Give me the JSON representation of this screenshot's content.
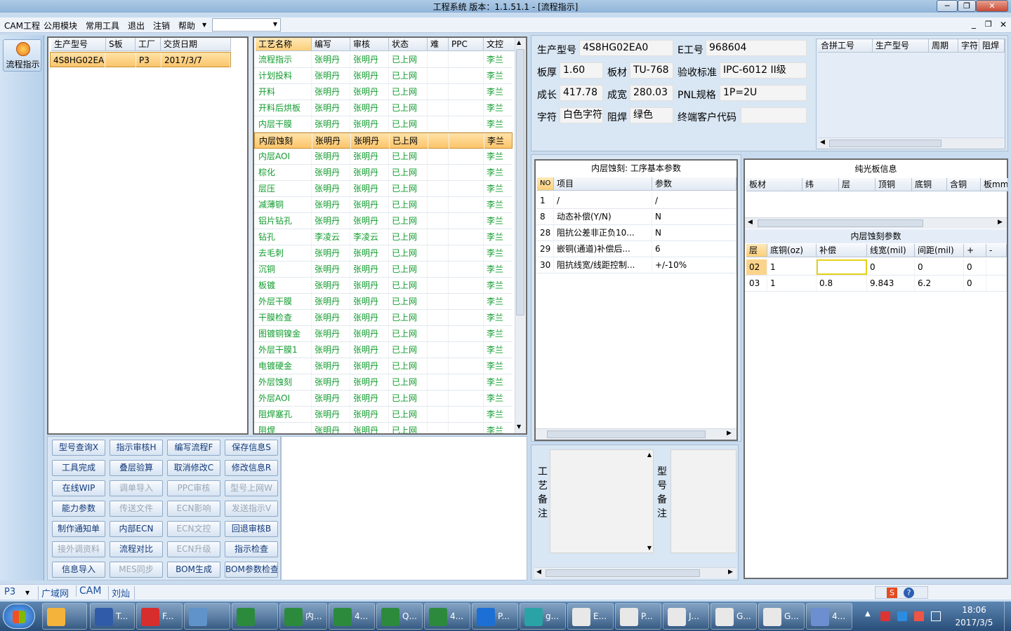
{
  "window": {
    "title": "工程系统   版本：1.1.51.1 - [流程指示]"
  },
  "menu": {
    "items": [
      "CAM工程",
      "公用模块",
      "常用工具",
      "退出",
      "注销",
      "帮助"
    ]
  },
  "left_nav": {
    "label": "流程指示"
  },
  "orders": {
    "headers": [
      "生产型号",
      "S板",
      "工厂",
      "交货日期"
    ],
    "rows": [
      {
        "model": "4S8HG02EA0",
        "s": "",
        "factory": "P3",
        "date": "2017/3/7"
      }
    ]
  },
  "process": {
    "headers": [
      "工艺名称",
      "编写",
      "审核",
      "状态",
      "难",
      "PPC",
      "文控"
    ],
    "rows": [
      [
        "流程指示",
        "张明丹",
        "张明丹",
        "已上网",
        "",
        "",
        "李兰"
      ],
      [
        "计划投料",
        "张明丹",
        "张明丹",
        "已上网",
        "",
        "",
        "李兰"
      ],
      [
        "开料",
        "张明丹",
        "张明丹",
        "已上网",
        "",
        "",
        "李兰"
      ],
      [
        "开料后烘板",
        "张明丹",
        "张明丹",
        "已上网",
        "",
        "",
        "李兰"
      ],
      [
        "内层干膜",
        "张明丹",
        "张明丹",
        "已上网",
        "",
        "",
        "李兰"
      ],
      [
        "内层蚀刻",
        "张明丹",
        "张明丹",
        "已上网",
        "",
        "",
        "李兰"
      ],
      [
        "内层AOI",
        "张明丹",
        "张明丹",
        "已上网",
        "",
        "",
        "李兰"
      ],
      [
        "棕化",
        "张明丹",
        "张明丹",
        "已上网",
        "",
        "",
        "李兰"
      ],
      [
        "层压",
        "张明丹",
        "张明丹",
        "已上网",
        "",
        "",
        "李兰"
      ],
      [
        "减薄铜",
        "张明丹",
        "张明丹",
        "已上网",
        "",
        "",
        "李兰"
      ],
      [
        "铝片钻孔",
        "张明丹",
        "张明丹",
        "已上网",
        "",
        "",
        "李兰"
      ],
      [
        "钻孔",
        "李凌云",
        "李凌云",
        "已上网",
        "",
        "",
        "李兰"
      ],
      [
        "去毛刺",
        "张明丹",
        "张明丹",
        "已上网",
        "",
        "",
        "李兰"
      ],
      [
        "沉铜",
        "张明丹",
        "张明丹",
        "已上网",
        "",
        "",
        "李兰"
      ],
      [
        "板镀",
        "张明丹",
        "张明丹",
        "已上网",
        "",
        "",
        "李兰"
      ],
      [
        "外层干膜",
        "张明丹",
        "张明丹",
        "已上网",
        "",
        "",
        "李兰"
      ],
      [
        "干膜检查",
        "张明丹",
        "张明丹",
        "已上网",
        "",
        "",
        "李兰"
      ],
      [
        "图镀铜镍金",
        "张明丹",
        "张明丹",
        "已上网",
        "",
        "",
        "李兰"
      ],
      [
        "外层干膜1",
        "张明丹",
        "张明丹",
        "已上网",
        "",
        "",
        "李兰"
      ],
      [
        "电镀硬金",
        "张明丹",
        "张明丹",
        "已上网",
        "",
        "",
        "李兰"
      ],
      [
        "外层蚀刻",
        "张明丹",
        "张明丹",
        "已上网",
        "",
        "",
        "李兰"
      ],
      [
        "外层AOI",
        "张明丹",
        "张明丹",
        "已上网",
        "",
        "",
        "李兰"
      ],
      [
        "阻焊塞孔",
        "张明丹",
        "张明丹",
        "已上网",
        "",
        "",
        "李兰"
      ],
      [
        "阻焊",
        "张明丹",
        "张明丹",
        "已上网",
        "",
        "",
        "李兰"
      ]
    ],
    "selected_index": 5
  },
  "buttons": [
    [
      "型号查询X",
      "指示审核H",
      "编写流程F",
      "保存信息S"
    ],
    [
      "工具完成",
      "叠层验算",
      "取消修改C",
      "修改信息R"
    ],
    [
      "在线WIP",
      "调单导入",
      "PPC审核",
      "型号上网W"
    ],
    [
      "能力参数",
      "传送文件",
      "ECN影响",
      "发送指示V"
    ],
    [
      "制作通知单",
      "内部ECN",
      "ECN文控",
      "回退审核B"
    ],
    [
      "接外调资料",
      "流程对比",
      "ECN升级",
      "指示检查"
    ],
    [
      "信息导入",
      "MES同步",
      "BOM生成",
      "BOM参数检查"
    ]
  ],
  "info": {
    "model_label": "生产型号",
    "model": "4S8HG02EA0",
    "e_label": "E工号",
    "e": "968604",
    "thick_label": "板厚",
    "thick": "1.60",
    "material_label": "板材",
    "material": "TU-768",
    "std_label": "验收标准",
    "std": "IPC-6012 II级",
    "len_label": "成长",
    "len": "417.78",
    "wid_label": "成宽",
    "wid": "280.03",
    "pnl_label": "PNL规格",
    "pnl": "1P=2U",
    "char_label": "字符",
    "char": "白色字符",
    "mask_label": "阻焊",
    "mask": "绿色",
    "cust_label": "终端客户代码",
    "cust": ""
  },
  "merge": {
    "headers": [
      "合拼工号",
      "生产型号",
      "周期",
      "字符",
      "阻焊"
    ]
  },
  "params": {
    "title": "内层蚀刻: 工序基本参数",
    "headers": [
      "NO",
      "项目",
      "参数"
    ],
    "rows": [
      [
        "1",
        "/",
        "/"
      ],
      [
        "8",
        "动态补偿(Y/N)",
        "N"
      ],
      [
        "28",
        "阻抗公差非正负10...",
        "N"
      ],
      [
        "29",
        "嵌铜(通道)补偿后...",
        "6"
      ],
      [
        "30",
        "阻抗线宽/线距控制...",
        "+/-10%"
      ]
    ]
  },
  "pure": {
    "title": "纯光板信息",
    "headers": [
      "板材",
      "纬",
      "层",
      "顶铜",
      "底铜",
      "含铜",
      "板mm"
    ]
  },
  "etch": {
    "title": "内层蚀刻参数",
    "headers": [
      "层",
      "底铜(oz)",
      "补偿",
      "线宽(mil)",
      "间距(mil)",
      "+",
      "-"
    ],
    "rows": [
      [
        "02",
        "1",
        "",
        "0",
        "0",
        "0",
        ""
      ],
      [
        "03",
        "1",
        "0.8",
        "9.843",
        "6.2",
        "0",
        ""
      ]
    ]
  },
  "notes": {
    "process_label": "工艺备注",
    "model_label": "型号备注"
  },
  "status": {
    "plant": "P3",
    "items": [
      "广域网",
      "CAM",
      "刘灿"
    ]
  },
  "taskbar": {
    "apps": [
      "T...",
      "F...",
      "",
      "",
      "内...",
      "4...",
      "Q...",
      "4...",
      "P...",
      "g...",
      "E...",
      "P...",
      "J...",
      "G...",
      "G...",
      "4..."
    ],
    "time": "18:06",
    "date": "2017/3/5"
  }
}
